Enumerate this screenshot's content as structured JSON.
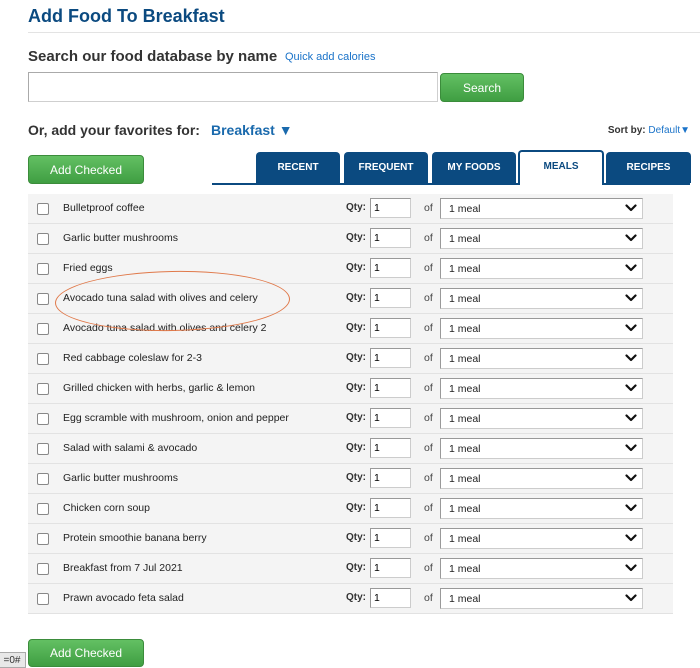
{
  "header": {
    "title": "Add Food To Breakfast"
  },
  "search": {
    "label": "Search our food database by name",
    "quick_add_link": "Quick add calories",
    "input_value": "",
    "input_placeholder": "",
    "button_label": "Search"
  },
  "favorites": {
    "label": "Or, add your favorites for:",
    "meal": "Breakfast",
    "meal_arrow": "▼"
  },
  "sort": {
    "label": "Sort by:",
    "value": "Default",
    "arrow": "▼"
  },
  "actions": {
    "add_checked_label": "Add Checked"
  },
  "tabs": [
    {
      "label": "RECENT",
      "active": false
    },
    {
      "label": "FREQUENT",
      "active": false
    },
    {
      "label": "MY FOODS",
      "active": false
    },
    {
      "label": "MEALS",
      "active": true
    },
    {
      "label": "RECIPES",
      "active": false
    }
  ],
  "table": {
    "qty_label": "Qty:",
    "of_label": "of",
    "rows": [
      {
        "name": "Bulletproof coffee",
        "checked": false,
        "qty": "1",
        "serving": "1 meal"
      },
      {
        "name": "Garlic butter mushrooms",
        "checked": false,
        "qty": "1",
        "serving": "1 meal"
      },
      {
        "name": "Fried eggs",
        "checked": false,
        "qty": "1",
        "serving": "1 meal"
      },
      {
        "name": "Avocado tuna salad with olives and celery",
        "checked": false,
        "qty": "1",
        "serving": "1 meal"
      },
      {
        "name": "Avocado tuna salad with olives and celery 2",
        "checked": false,
        "qty": "1",
        "serving": "1 meal"
      },
      {
        "name": "Red cabbage coleslaw for 2-3",
        "checked": false,
        "qty": "1",
        "serving": "1 meal"
      },
      {
        "name": "Grilled chicken with herbs, garlic & lemon",
        "checked": false,
        "qty": "1",
        "serving": "1 meal"
      },
      {
        "name": "Egg scramble with mushroom, onion and pepper",
        "checked": false,
        "qty": "1",
        "serving": "1 meal"
      },
      {
        "name": "Salad with salami & avocado",
        "checked": false,
        "qty": "1",
        "serving": "1 meal"
      },
      {
        "name": "Garlic butter mushrooms",
        "checked": false,
        "qty": "1",
        "serving": "1 meal"
      },
      {
        "name": "Chicken corn soup",
        "checked": false,
        "qty": "1",
        "serving": "1 meal"
      },
      {
        "name": "Protein smoothie banana berry",
        "checked": false,
        "qty": "1",
        "serving": "1 meal"
      },
      {
        "name": "Breakfast from 7 Jul 2021",
        "checked": false,
        "qty": "1",
        "serving": "1 meal"
      },
      {
        "name": "Prawn avocado feta salad",
        "checked": false,
        "qty": "1",
        "serving": "1 meal"
      }
    ]
  },
  "annotation": {
    "highlighted_row": "Avocado tuna salad with olives and celery",
    "color": "#e0794a"
  },
  "tooltip": {
    "text": "=0#"
  },
  "colors": {
    "brand_blue": "#0b4a80",
    "link_blue": "#1a73c9",
    "button_green": "#4caf50"
  }
}
